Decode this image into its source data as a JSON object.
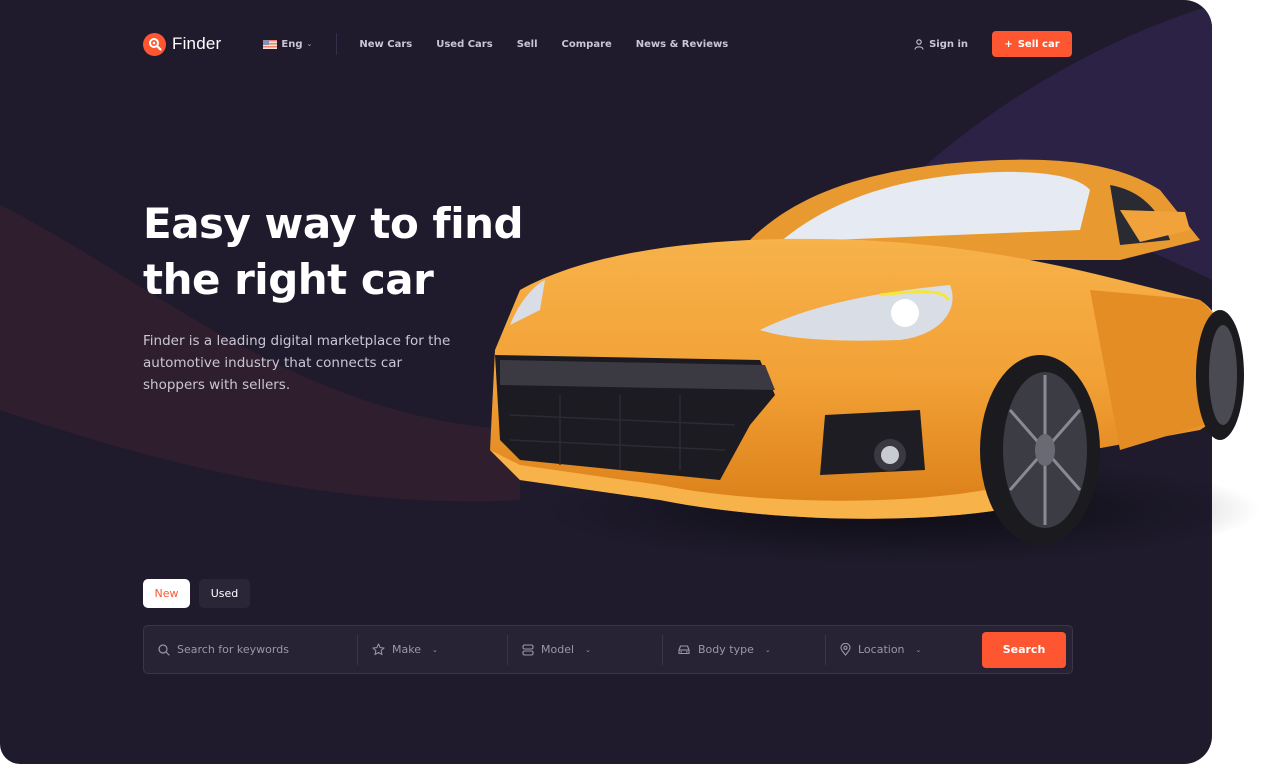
{
  "brand": {
    "name": "Finder",
    "accent_color": "#fd5631",
    "background_color": "#1f1b2d"
  },
  "header": {
    "language": {
      "flag": "us-flag-icon",
      "label": "Eng"
    },
    "nav": [
      {
        "label": "New Cars"
      },
      {
        "label": "Used Cars"
      },
      {
        "label": "Sell"
      },
      {
        "label": "Compare"
      },
      {
        "label": "News & Reviews"
      }
    ],
    "sign_in_label": "Sign in",
    "sell_car_label": "Sell car"
  },
  "hero": {
    "title_line1": "Easy way to find",
    "title_line2": "the right car",
    "description": "Finder is a leading digital marketplace for the automotive industry that connects car shoppers with sellers.",
    "image": "orange-sports-car"
  },
  "search": {
    "tabs": [
      {
        "label": "New",
        "active": true
      },
      {
        "label": "Used",
        "active": false
      }
    ],
    "keywords_placeholder": "Search for keywords",
    "keywords_value": "",
    "make_label": "Make",
    "model_label": "Model",
    "body_type_label": "Body type",
    "location_label": "Location",
    "search_button_label": "Search"
  }
}
